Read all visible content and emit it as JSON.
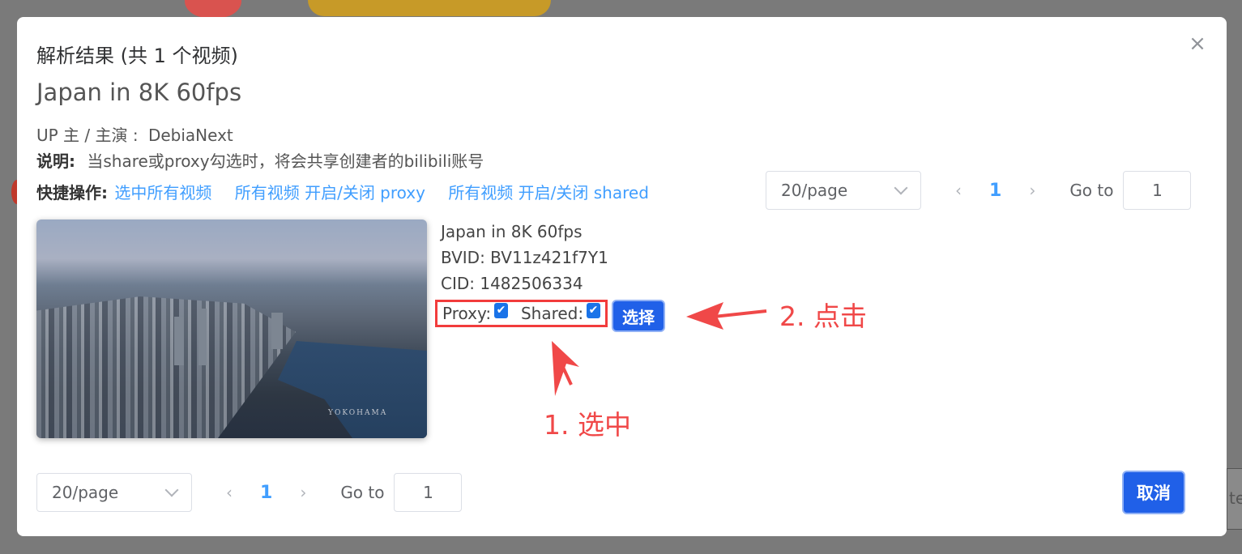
{
  "dialog": {
    "title": "解析结果 (共 1 个视频)",
    "close_icon": "close-icon",
    "video_title": "Japan in 8K 60fps",
    "up_label": "UP 主 / 主演 :",
    "up_value": "DebiaNext",
    "note_label": "说明:",
    "note_value": "当share或proxy勾选时，将会共享创建者的bilibili账号",
    "quick_label": "快捷操作:",
    "quick_links": [
      "选中所有视频",
      "所有视频 开启/关闭 proxy",
      "所有视频 开启/关闭 shared"
    ]
  },
  "pager_top": {
    "page_size": "20/page",
    "current_page": "1",
    "goto_label": "Go to",
    "goto_value": "1"
  },
  "pager_bottom": {
    "page_size": "20/page",
    "current_page": "1",
    "goto_label": "Go to",
    "goto_value": "1"
  },
  "video": {
    "title": "Japan in 8K 60fps",
    "bvid": "BVID: BV11z421f7Y1",
    "cid": "CID: 1482506334",
    "proxy_label": "Proxy:",
    "proxy_checked": true,
    "shared_label": "Shared:",
    "shared_checked": true,
    "select_button": "选择",
    "thumbnail_watermark": "YOKOHAMA"
  },
  "annotations": {
    "step1": "1. 选中",
    "step2": "2. 点击",
    "color": "#f04848"
  },
  "footer": {
    "cancel_button": "取消"
  },
  "background": {
    "partial_text": "te"
  }
}
